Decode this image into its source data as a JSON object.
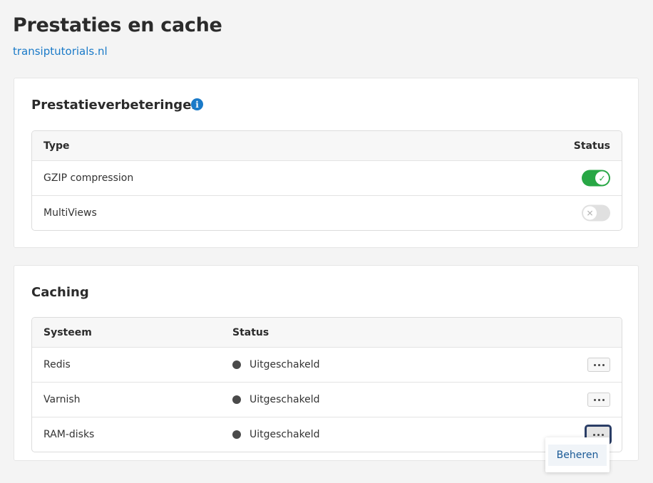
{
  "page": {
    "title": "Prestaties en cache",
    "domain_link": "transiptutorials.nl"
  },
  "performance": {
    "title": "Prestatieverbeteringen",
    "info_icon": "info-icon",
    "columns": {
      "type": "Type",
      "status": "Status"
    },
    "rows": [
      {
        "label": "GZIP compression",
        "enabled": true
      },
      {
        "label": "MultiViews",
        "enabled": false
      }
    ]
  },
  "caching": {
    "title": "Caching",
    "columns": {
      "system": "Systeem",
      "status": "Status"
    },
    "rows": [
      {
        "system": "Redis",
        "status": "Uitgeschakeld"
      },
      {
        "system": "Varnish",
        "status": "Uitgeschakeld"
      },
      {
        "system": "RAM-disks",
        "status": "Uitgeschakeld"
      }
    ]
  },
  "dropdown": {
    "items": [
      "Beheren"
    ]
  },
  "colors": {
    "accent": "#1a7ac8",
    "toggle_on": "#28a745",
    "toggle_off": "#e0e0e0",
    "status_dot": "#4a4a4a"
  }
}
